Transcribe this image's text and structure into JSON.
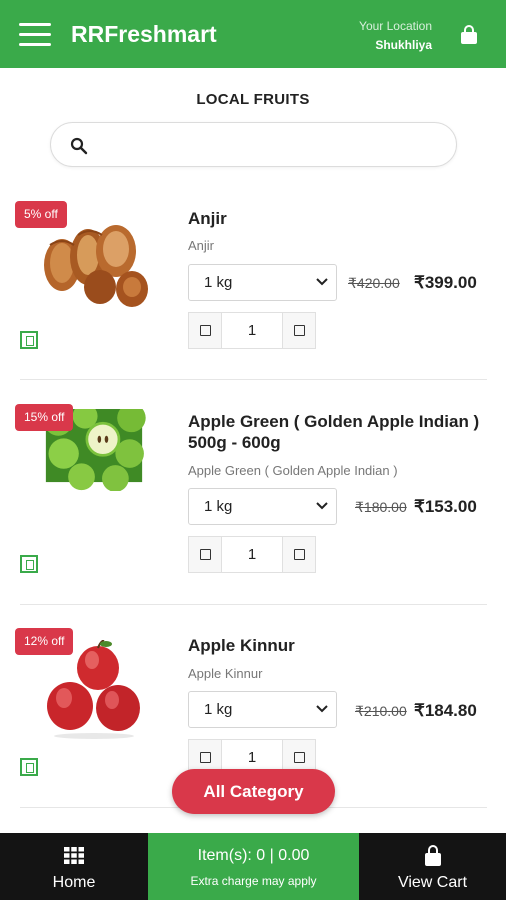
{
  "header": {
    "brand": "RRFreshmart",
    "location_label": "Your Location",
    "location_value": "Shukhliya"
  },
  "page": {
    "title": "LOCAL FRUITS",
    "search_placeholder": ""
  },
  "products": [
    {
      "badge": "5% off",
      "name": "Anjir",
      "subtitle": "Anjir",
      "unit": "1 kg",
      "mrp": "₹420.00",
      "price": "₹399.00",
      "qty": "1"
    },
    {
      "badge": "15% off",
      "name": "Apple Green ( Golden Apple Indian ) 500g - 600g",
      "subtitle": "Apple Green ( Golden Apple Indian )",
      "unit": "1 kg",
      "mrp": "₹180.00",
      "price": "₹153.00",
      "qty": "1"
    },
    {
      "badge": "12% off",
      "name": "Apple Kinnur",
      "subtitle": "Apple Kinnur",
      "unit": "1 kg",
      "mrp": "₹210.00",
      "price": "₹184.80",
      "qty": "1"
    }
  ],
  "fab": {
    "label": "All Category"
  },
  "bottom_bar": {
    "home_label": "Home",
    "items_text": "Item(s): 0 | 0.00",
    "extra_text": "Extra charge may apply",
    "cart_label": "View Cart"
  },
  "colors": {
    "brand_green": "#3aaa4a",
    "badge_red": "#d9384a",
    "bottom_dark": "#141414"
  },
  "icons": [
    "menu-icon",
    "shopping-bag-icon",
    "search-icon",
    "chevron-down-icon",
    "veg-mark-icon",
    "grid-icon"
  ]
}
